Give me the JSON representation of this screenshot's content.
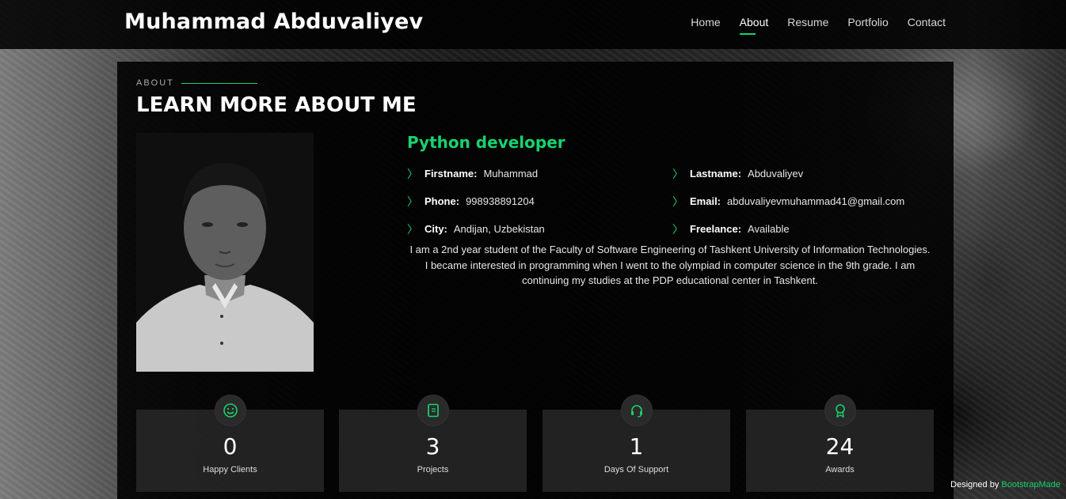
{
  "header": {
    "logo": "Muhammad Abduvaliyev",
    "nav": [
      {
        "label": "Home"
      },
      {
        "label": "About"
      },
      {
        "label": "Resume"
      },
      {
        "label": "Portfolio"
      },
      {
        "label": "Contact"
      }
    ],
    "active": "About"
  },
  "about": {
    "subtitle": "ABOUT",
    "title": "LEARN MORE ABOUT ME",
    "role": "Python developer",
    "fields": [
      {
        "label": "Firstname:",
        "value": "Muhammad"
      },
      {
        "label": "Lastname:",
        "value": "Abduvaliyev"
      },
      {
        "label": "Phone:",
        "value": "998938891204"
      },
      {
        "label": "Email:",
        "value": "abduvaliyevmuhammad41@gmail.com"
      },
      {
        "label": "City:",
        "value": "Andijan, Uzbekistan"
      },
      {
        "label": "Freelance:",
        "value": "Available"
      }
    ],
    "bio": "I am a 2nd year student of the Faculty of Software Engineering of Tashkent University of Information Technologies. I became interested in programming when I went to the olympiad in computer science in the 9th grade. I am continuing my studies at the PDP educational center in Tashkent."
  },
  "stats": [
    {
      "icon": "smile-icon",
      "value": "0",
      "label": "Happy Clients"
    },
    {
      "icon": "journal-icon",
      "value": "3",
      "label": "Projects"
    },
    {
      "icon": "headset-icon",
      "value": "1",
      "label": "Days Of Support"
    },
    {
      "icon": "award-icon",
      "value": "24",
      "label": "Awards"
    }
  ],
  "credits": {
    "text": "Designed by ",
    "link": "BootstrapMade"
  },
  "colors": {
    "accent": "#18d26e",
    "panel": "#000000"
  }
}
